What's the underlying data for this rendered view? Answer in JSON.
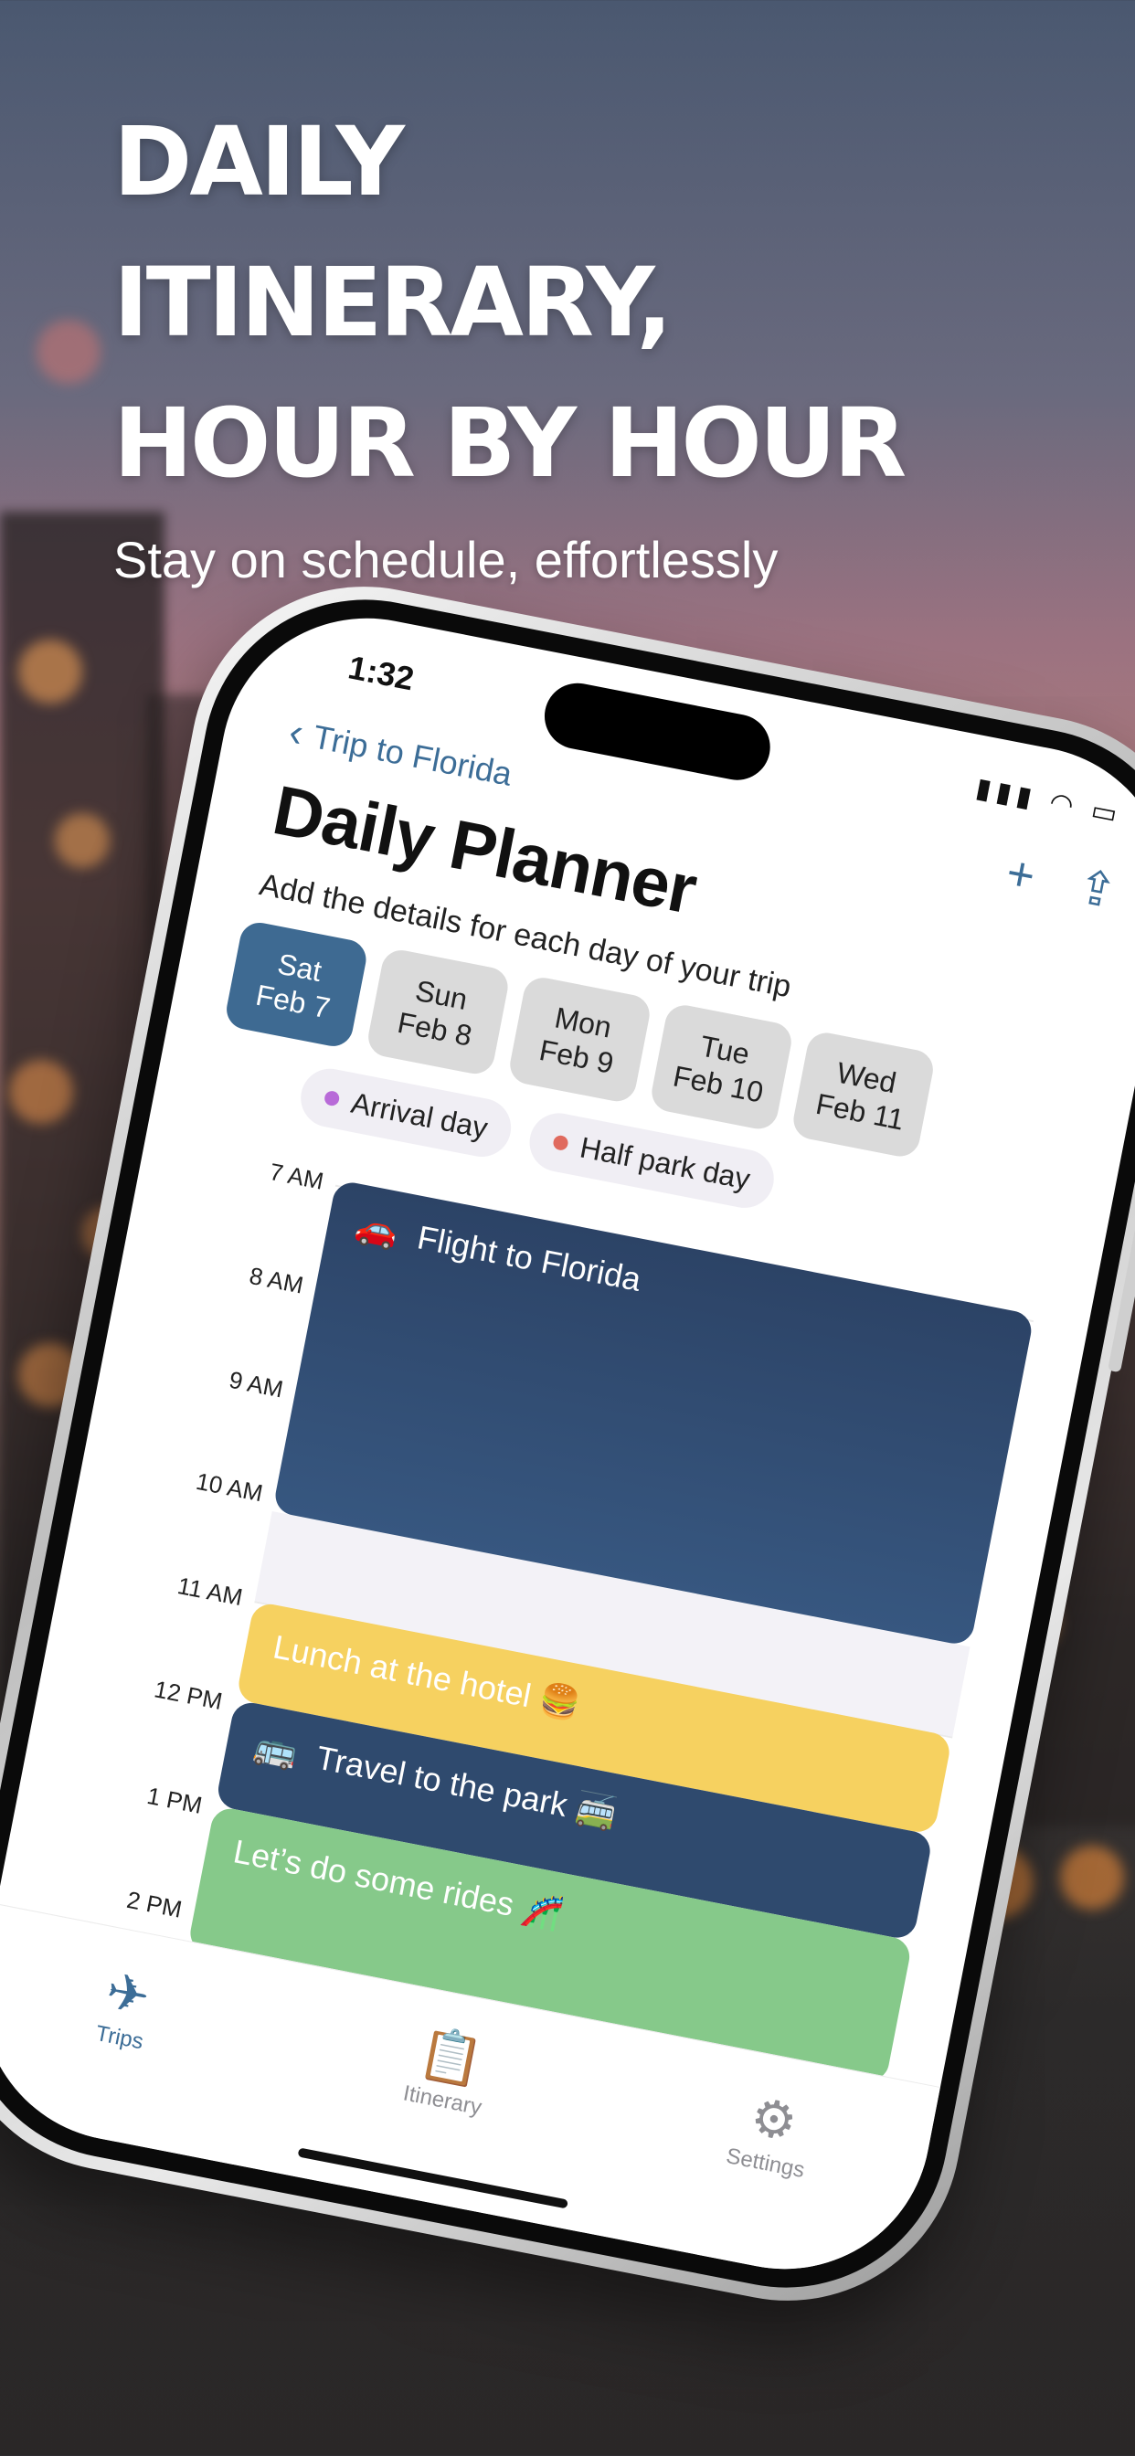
{
  "marketing": {
    "headline": "DAILY\nITINERARY,\nHOUR BY HOUR",
    "subtitle": "Stay on schedule, effortlessly"
  },
  "status_bar": {
    "time": "1:32"
  },
  "nav": {
    "back_label": "Trip to Florida",
    "add_icon": "plus-icon",
    "share_icon": "share-icon"
  },
  "page": {
    "title": "Daily Planner",
    "subtitle": "Add the details for each day of your trip"
  },
  "days": [
    {
      "weekday": "Sat",
      "date": "Feb 7",
      "selected": true
    },
    {
      "weekday": "Sun",
      "date": "Feb 8",
      "selected": false
    },
    {
      "weekday": "Mon",
      "date": "Feb 9",
      "selected": false
    },
    {
      "weekday": "Tue",
      "date": "Feb 10",
      "selected": false
    },
    {
      "weekday": "Wed",
      "date": "Feb 11",
      "selected": false
    }
  ],
  "tags": [
    {
      "label": "Arrival day",
      "color": "#b86ad8"
    },
    {
      "label": "Half park day",
      "color": "#e06a5e"
    }
  ],
  "timeline": {
    "hours": [
      "7 AM",
      "8 AM",
      "9 AM",
      "10 AM",
      "11 AM",
      "12 PM",
      "1 PM",
      "2 PM"
    ],
    "events": [
      {
        "title": "Flight to Florida",
        "icon": "car-icon",
        "color": "#2f4a6e"
      },
      {
        "title": "Lunch at the hotel 🍔",
        "icon": "",
        "color": "#f6d160"
      },
      {
        "title": "Travel to the park 🚎",
        "icon": "bus-icon",
        "color": "#2f4a6e"
      },
      {
        "title": "Let’s do some rides 🎢",
        "icon": "",
        "color": "#86c98a"
      }
    ]
  },
  "tab_bar": {
    "items": [
      {
        "label": "Trips",
        "icon": "airplane-icon",
        "active": true
      },
      {
        "label": "Itinerary",
        "icon": "clipboard-icon",
        "active": false
      },
      {
        "label": "Settings",
        "icon": "gear-icon",
        "active": false
      }
    ]
  }
}
